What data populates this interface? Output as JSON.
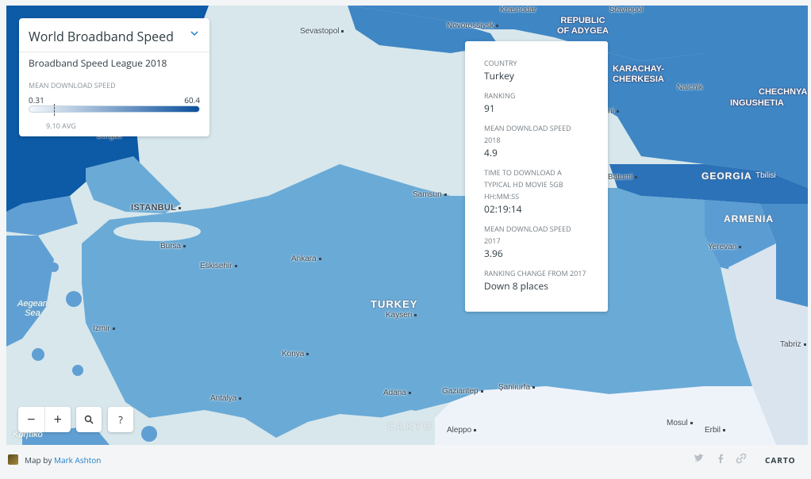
{
  "legend": {
    "title": "World Broadband Speed",
    "subtitle": "Broadband Speed League 2018",
    "legend_title": "MEAN DOWNLOAD SPEED",
    "min": "0.31",
    "max": "60.4",
    "avg_label": "9.10 AVG",
    "avg_value": 9.1,
    "min_value": 0.31,
    "max_value": 60.4,
    "color_low": "#f4f8fb",
    "color_high": "#0b4f9c",
    "collapse_icon": "chevron-down-icon"
  },
  "popup": {
    "fields": [
      {
        "key": "COUNTRY",
        "value": "Turkey"
      },
      {
        "key": "RANKING",
        "value": "91"
      },
      {
        "key": "MEAN DOWNLOAD SPEED 2018",
        "value": "4.9"
      },
      {
        "key": "TIME TO DOWNLOAD A TYPICAL HD MOVIE 5GB HH:MM:SS",
        "value": "02:19:14"
      },
      {
        "key": "MEAN DOWNLOAD SPEED 2017",
        "value": "3.96"
      },
      {
        "key": "RANKING CHANGE FROM 2017",
        "value": "Down 8 places"
      }
    ]
  },
  "map_labels": {
    "cities": [
      "Krasnodar",
      "Stavropol",
      "Sevastopol",
      "Novorossiysk",
      "Nalchik",
      "Batumi",
      "Tbilisi",
      "Samsun",
      "Bursa",
      "Eskisehir",
      "Ankara",
      "Izmir",
      "Kayseri",
      "Konya",
      "Antalya",
      "Adana",
      "Gaziantep",
      "Şanlıurfa",
      "Aleppo",
      "Mosul",
      "Erbil",
      "Yerevan",
      "Tabriz",
      "Burgas",
      "ni"
    ],
    "istanbul": "ISTANBUL",
    "country_turkey": "TURKEY",
    "country_georgia": "GEORGIA",
    "country_armenia": "ARMENIA",
    "region_adygea": "REPUBLIC\nOF ADYGEA",
    "region_karachay": "KARACHAY-\nCHERKESIA",
    "region_chechnya": "CHECHNYA",
    "region_ingushetia": "INGUSHETIA",
    "sea_aegean": "Aegean\nSea",
    "sea_crete": "Κρητικό",
    "watermark": "CARTO",
    "region_colors": {
      "turkey": "#6aaad6",
      "russia": "#3f86c4",
      "bulgaria": "#0d5aa6",
      "greece": "#5f9fd3",
      "georgia": "#2b72b8",
      "armenia": "#5b9dd3",
      "syria_iraq": "#eef3fa",
      "iran": "#d9e4ef",
      "sea": "#d7e7ec"
    }
  },
  "controls": {
    "zoom_out": "−",
    "zoom_in": "+",
    "search_icon": "search-icon",
    "help": "?"
  },
  "footer": {
    "map_by": "Map by",
    "author": "Mark Ashton",
    "brand": "CARTO",
    "social_icons": [
      "twitter-icon",
      "facebook-icon",
      "link-icon"
    ]
  }
}
